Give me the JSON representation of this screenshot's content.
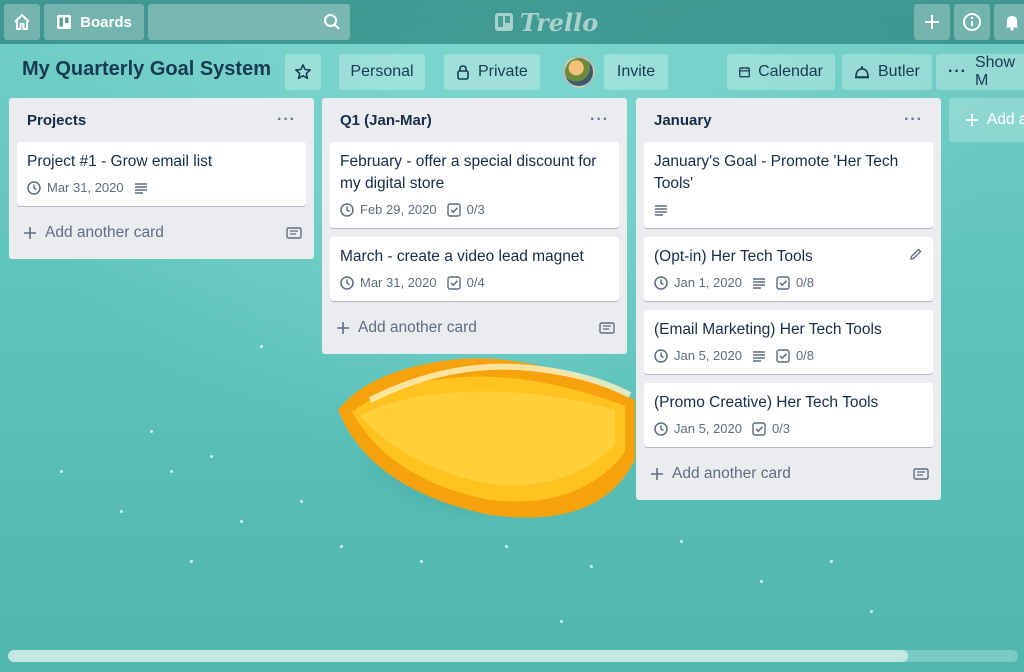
{
  "header": {
    "boards_label": "Boards",
    "logo_text": "Trello",
    "icons": [
      "home-icon",
      "boards-icon",
      "search-icon",
      "plus-icon",
      "info-icon",
      "bell-icon"
    ]
  },
  "board": {
    "title": "My Quarterly Goal System",
    "team_label": "Personal",
    "visibility_label": "Private",
    "invite_label": "Invite",
    "calendar_label": "Calendar",
    "butler_label": "Butler",
    "show_menu_label": "Show M"
  },
  "lists": [
    {
      "title": "Projects",
      "cards": [
        {
          "title": "Project #1 - Grow email list",
          "due": "Mar 31, 2020",
          "has_description": true
        }
      ],
      "add_card_label": "Add another card"
    },
    {
      "title": "Q1 (Jan-Mar)",
      "cards": [
        {
          "title": "February - offer a special discount for my digital store",
          "due": "Feb 29, 2020",
          "checklist": "0/3"
        },
        {
          "title": "March - create a video lead magnet",
          "due": "Mar 31, 2020",
          "checklist": "0/4"
        }
      ],
      "add_card_label": "Add another card"
    },
    {
      "title": "January",
      "cards": [
        {
          "title": "January's Goal - Promote 'Her Tech Tools'",
          "has_description": true
        },
        {
          "title": "(Opt-in) Her Tech Tools",
          "due": "Jan 1, 2020",
          "has_description": true,
          "checklist": "0/8"
        },
        {
          "title": "(Email Marketing) Her Tech Tools",
          "due": "Jan 5, 2020",
          "has_description": true,
          "checklist": "0/8"
        },
        {
          "title": "(Promo Creative) Her Tech Tools",
          "due": "Jan 5, 2020",
          "checklist": "0/3"
        }
      ],
      "add_card_label": "Add another card"
    }
  ],
  "add_list_label": "Add a",
  "colors": {
    "background": "#5fc4bd",
    "list_bg": "#ebecf0",
    "title_text": "#173b52",
    "card_text": "#172b4d",
    "meta_text": "#5e6c84"
  }
}
